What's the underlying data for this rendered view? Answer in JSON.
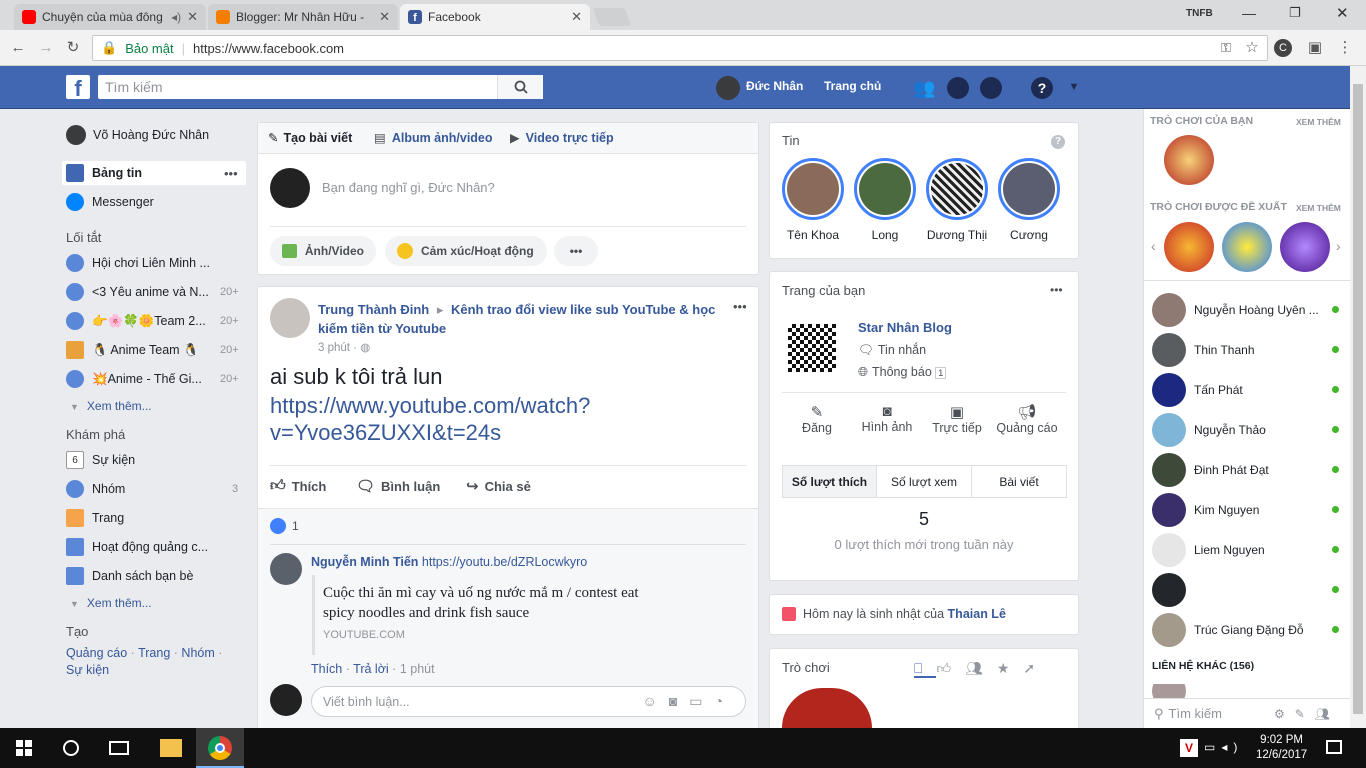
{
  "browser": {
    "tabs": [
      {
        "title": "Chuyện của mùa đông",
        "color": "#ff0000"
      },
      {
        "title": "Blogger: Mr Nhân Hữu -",
        "color": "#f57d00"
      },
      {
        "title": "Facebook",
        "color": "#3b5998"
      }
    ],
    "profile_badge": "TNFB",
    "secure_label": "Bảo mật",
    "url": "https://www.facebook.com"
  },
  "fb": {
    "search_placeholder": "Tìm kiếm",
    "user_name": "Đức Nhân",
    "home_label": "Trang chủ"
  },
  "left": {
    "profile": "Võ Hoàng Đức Nhân",
    "main_items": [
      {
        "label": "Bảng tin"
      },
      {
        "label": "Messenger"
      }
    ],
    "shortcuts_title": "Lối tắt",
    "shortcuts": [
      {
        "label": "Hội chơi Liên Minh ...",
        "count": ""
      },
      {
        "label": "<3 Yêu anime và N...",
        "count": "20+"
      },
      {
        "label": "👉🌸🍀🌼Team 2...",
        "count": "20+"
      },
      {
        "label": "🐧 Anime Team 🐧",
        "count": "20+"
      },
      {
        "label": "💥Anime - Thế Gi...",
        "count": "20+"
      }
    ],
    "see_more": "Xem thêm...",
    "explore_title": "Khám phá",
    "explore": [
      {
        "label": "Sự kiện",
        "count": ""
      },
      {
        "label": "Nhóm",
        "count": "3"
      },
      {
        "label": "Trang",
        "count": ""
      },
      {
        "label": "Hoạt động quảng c...",
        "count": ""
      },
      {
        "label": "Danh sách bạn bè",
        "count": ""
      }
    ],
    "create_title": "Tạo",
    "create_links": [
      "Quảng cáo",
      "Trang",
      "Nhóm",
      "Sự kiện"
    ],
    "create_sep": "·"
  },
  "composer": {
    "tabs": [
      "Tạo bài viết",
      "Album ảnh/video",
      "Video trực tiếp"
    ],
    "placeholder": "Bạn đang nghĩ gì, Đức Nhân?",
    "photo_btn": "Ảnh/Video",
    "feeling_btn": "Cảm xúc/Hoạt động",
    "more_btn": "•••"
  },
  "post": {
    "author": "Trung Thành Đinh",
    "arrow": "▸",
    "group": "Kênh trao đổi view like sub YouTube & học kiếm tiền từ Youtube",
    "time": "3 phút",
    "text_line1": "ai sub k tôi trả lun",
    "link_line1": "https://www.youtube.com/watch?",
    "link_line2": "v=Yvoe36ZUXXI&t=24s",
    "like": "Thích",
    "comment": "Bình luận",
    "share": "Chia sẻ",
    "reactions": "1",
    "comment_author": "Nguyễn Minh Tiến",
    "comment_link": "https://youtu.be/dZRLocwkyro",
    "preview_title1": "Cuộc thi ăn mì cay và uố ng nước mắ m / contest eat",
    "preview_title2": "spicy noodles and drink fish sauce",
    "preview_domain": "YOUTUBE.COM",
    "comment_like": "Thích",
    "comment_reply": "Trả lời",
    "comment_time": "1 phút",
    "comment_sep": "·",
    "write_comment": "Viết bình luận..."
  },
  "stories": {
    "title": "Tin",
    "help": "?",
    "people": [
      "Tên Khoa",
      "Long",
      "Dương Thịi",
      "Cương"
    ]
  },
  "pages": {
    "title": "Trang của bạn",
    "page_name": "Star Nhân Blog",
    "messages": "Tin nhắn",
    "notifications": "Thông báo",
    "notif_count": "1",
    "actions": [
      "Đăng",
      "Hình ảnh",
      "Trực tiếp",
      "Quảng cáo"
    ],
    "tabs": [
      "Số lượt thích",
      "Số lượt xem",
      "Bài viết"
    ],
    "stat_value": "5",
    "stat_label": "0 lượt thích mới trong tuần này"
  },
  "birthday": {
    "text": "Hôm nay là sinh nhật của",
    "name": "Thaian Lê"
  },
  "games": {
    "title": "Trò chơi"
  },
  "chat": {
    "your_games": "TRÒ CHƠI CỦA BẠN",
    "see_more": "XEM THÊM",
    "suggested": "TRÒ CHƠI ĐƯỢC ĐỀ XUẤT",
    "friends": [
      {
        "name": "Nguyễn Hoàng Uyên ...",
        "online": true
      },
      {
        "name": "Thin Thanh",
        "online": true
      },
      {
        "name": "Tấn Phát",
        "online": true
      },
      {
        "name": "Nguyễn Thảo",
        "online": true
      },
      {
        "name": "Đinh Phát Đạt",
        "online": true
      },
      {
        "name": "Kim Nguyen",
        "online": true
      },
      {
        "name": "Liem Nguyen",
        "online": true
      },
      {
        "name": "",
        "online": true
      },
      {
        "name": "Trúc Giang Đặng Đỗ",
        "online": true
      }
    ],
    "other_contacts": "LIÊN HỆ KHÁC (156)",
    "search_placeholder": "Tìm kiếm"
  },
  "taskbar": {
    "time": "9:02 PM",
    "date": "12/6/2017"
  }
}
